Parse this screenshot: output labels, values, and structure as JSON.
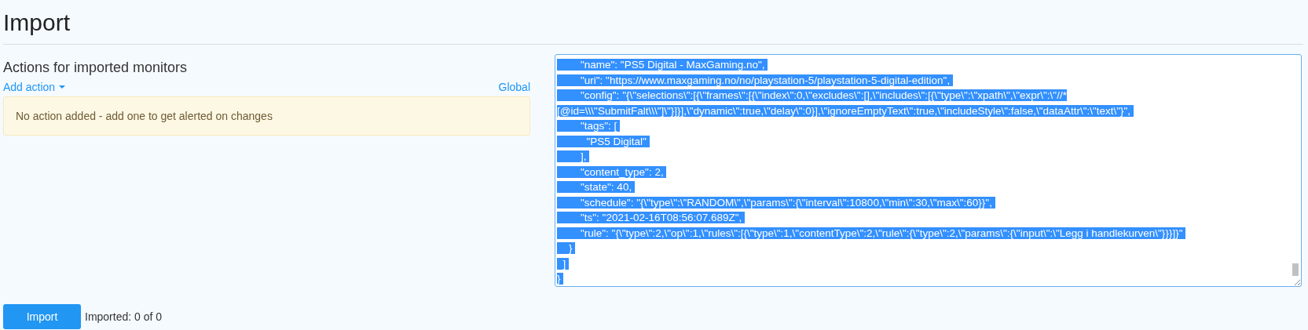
{
  "title": "Import",
  "actions": {
    "heading": "Actions for imported monitors",
    "add_action": "Add action",
    "scope": "Global",
    "empty_message": "No action added - add one to get alerted on changes"
  },
  "editor": {
    "text_selected": true,
    "lines": [
      "        \"name\": \"PS5 Digital - MaxGaming.no\",",
      "        \"uri\": \"https://www.maxgaming.no/no/playstation-5/playstation-5-digital-edition\",",
      "        \"config\": \"{\\\"selections\\\":[{\\\"frames\\\":[{\\\"index\\\":0,\\\"excludes\\\":[],\\\"includes\\\":[{\\\"type\\\":\\\"xpath\\\",\\\"expr\\\":\\\"//*[@id=\\\\\\\"SubmitFalt\\\\\\\"]\\\"}]}],\\\"dynamic\\\":true,\\\"delay\\\":0}],\\\"ignoreEmptyText\\\":true,\\\"includeStyle\\\":false,\\\"dataAttr\\\":\\\"text\\\"}\",",
      "        \"tags\": [",
      "          \"PS5 Digital\"",
      "        ],",
      "        \"content_type\": 2,",
      "        \"state\": 40,",
      "        \"schedule\": \"{\\\"type\\\":\\\"RANDOM\\\",\\\"params\\\":{\\\"interval\\\":10800,\\\"min\\\":30,\\\"max\\\":60}}\",",
      "        \"ts\": \"2021-02-16T08:56:07.689Z\",",
      "        \"rule\": \"{\\\"type\\\":2,\\\"op\\\":1,\\\"rules\\\":[{\\\"type\\\":1,\\\"contentType\\\":2,\\\"rule\\\":{\\\"type\\\":2,\\\"params\\\":{\\\"input\\\":\\\"Legg i handlekurven\\\"}}}]}\"",
      "    }",
      "  ]",
      "}"
    ]
  },
  "import_button": "Import",
  "status": "Imported: 0 of 0"
}
